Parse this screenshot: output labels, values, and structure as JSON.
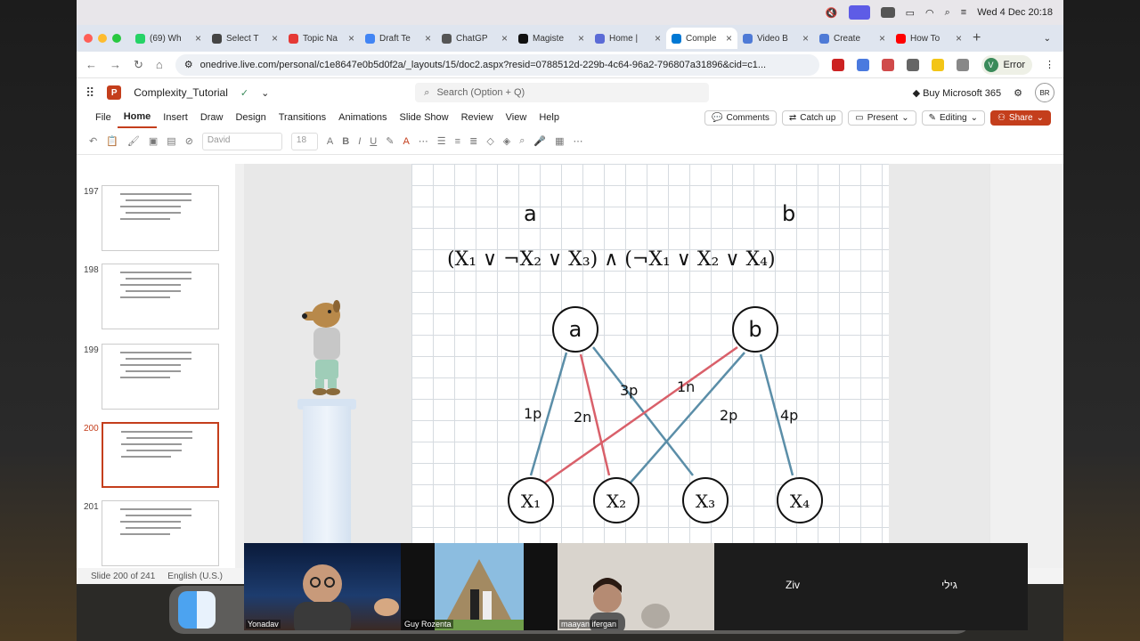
{
  "menubar": {
    "datetime": "Wed 4 Dec  20:18"
  },
  "browser": {
    "tabs": [
      {
        "label": "(69) Wh",
        "color": "#25d366"
      },
      {
        "label": "Select T",
        "color": "#444444"
      },
      {
        "label": "Topic Na",
        "color": "#e53935"
      },
      {
        "label": "Draft Te",
        "color": "#4285f4"
      },
      {
        "label": "ChatGP",
        "color": "#555555"
      },
      {
        "label": "Magiste",
        "color": "#111111"
      },
      {
        "label": "Home |",
        "color": "#5b6bd6"
      },
      {
        "label": "Comple",
        "color": "#0078d4",
        "active": true
      },
      {
        "label": "Video B",
        "color": "#4e7ad6"
      },
      {
        "label": "Create",
        "color": "#4e7ad6"
      },
      {
        "label": "How To",
        "color": "#ff0000"
      }
    ],
    "url": "onedrive.live.com/personal/c1e8647e0b5d0f2a/_layouts/15/doc2.aspx?resid=0788512d-229b-4c64-96a2-796807a31896&cid=c1...",
    "error_label": "Error",
    "avatar_letter": "V"
  },
  "app": {
    "doc_title": "Complexity_Tutorial",
    "search_placeholder": "Search (Option + Q)",
    "buy_label": "Buy Microsoft 365",
    "user_initials": "BR",
    "ribbon_tabs": [
      "File",
      "Home",
      "Insert",
      "Draw",
      "Design",
      "Transitions",
      "Animations",
      "Slide Show",
      "Review",
      "View",
      "Help"
    ],
    "active_tab": "Home",
    "comments_label": "Comments",
    "catchup_label": "Catch up",
    "present_label": "Present",
    "editing_label": "Editing",
    "share_label": "Share",
    "font_name": "David",
    "font_size": "18"
  },
  "slides": {
    "thumbs": [
      {
        "num": "197"
      },
      {
        "num": "198"
      },
      {
        "num": "199"
      },
      {
        "num": "200",
        "selected": true
      },
      {
        "num": "201"
      }
    ]
  },
  "slide": {
    "label_a": "a",
    "label_b": "b",
    "formula": "(X₁ ∨ ¬X₂ ∨ X₃)   ∧   (¬X₁ ∨ X₂ ∨ X₄)",
    "node_a": "a",
    "node_b": "b",
    "vars": [
      "X₁",
      "X₂",
      "X₃",
      "X₄"
    ],
    "edge_labels": [
      "1p",
      "2n",
      "3p",
      "1n",
      "2p",
      "4p"
    ]
  },
  "status": {
    "slide_info": "Slide 200 of 241",
    "language": "English (U.S.)"
  },
  "video": {
    "participants": [
      "Yonadav",
      "Guy Rozenta",
      "maayan ifergan",
      "Ziv",
      "גילי"
    ]
  },
  "colors": {
    "accent": "#c43e1c",
    "edge_blue": "#5b8ea8",
    "edge_red": "#d9606a"
  }
}
